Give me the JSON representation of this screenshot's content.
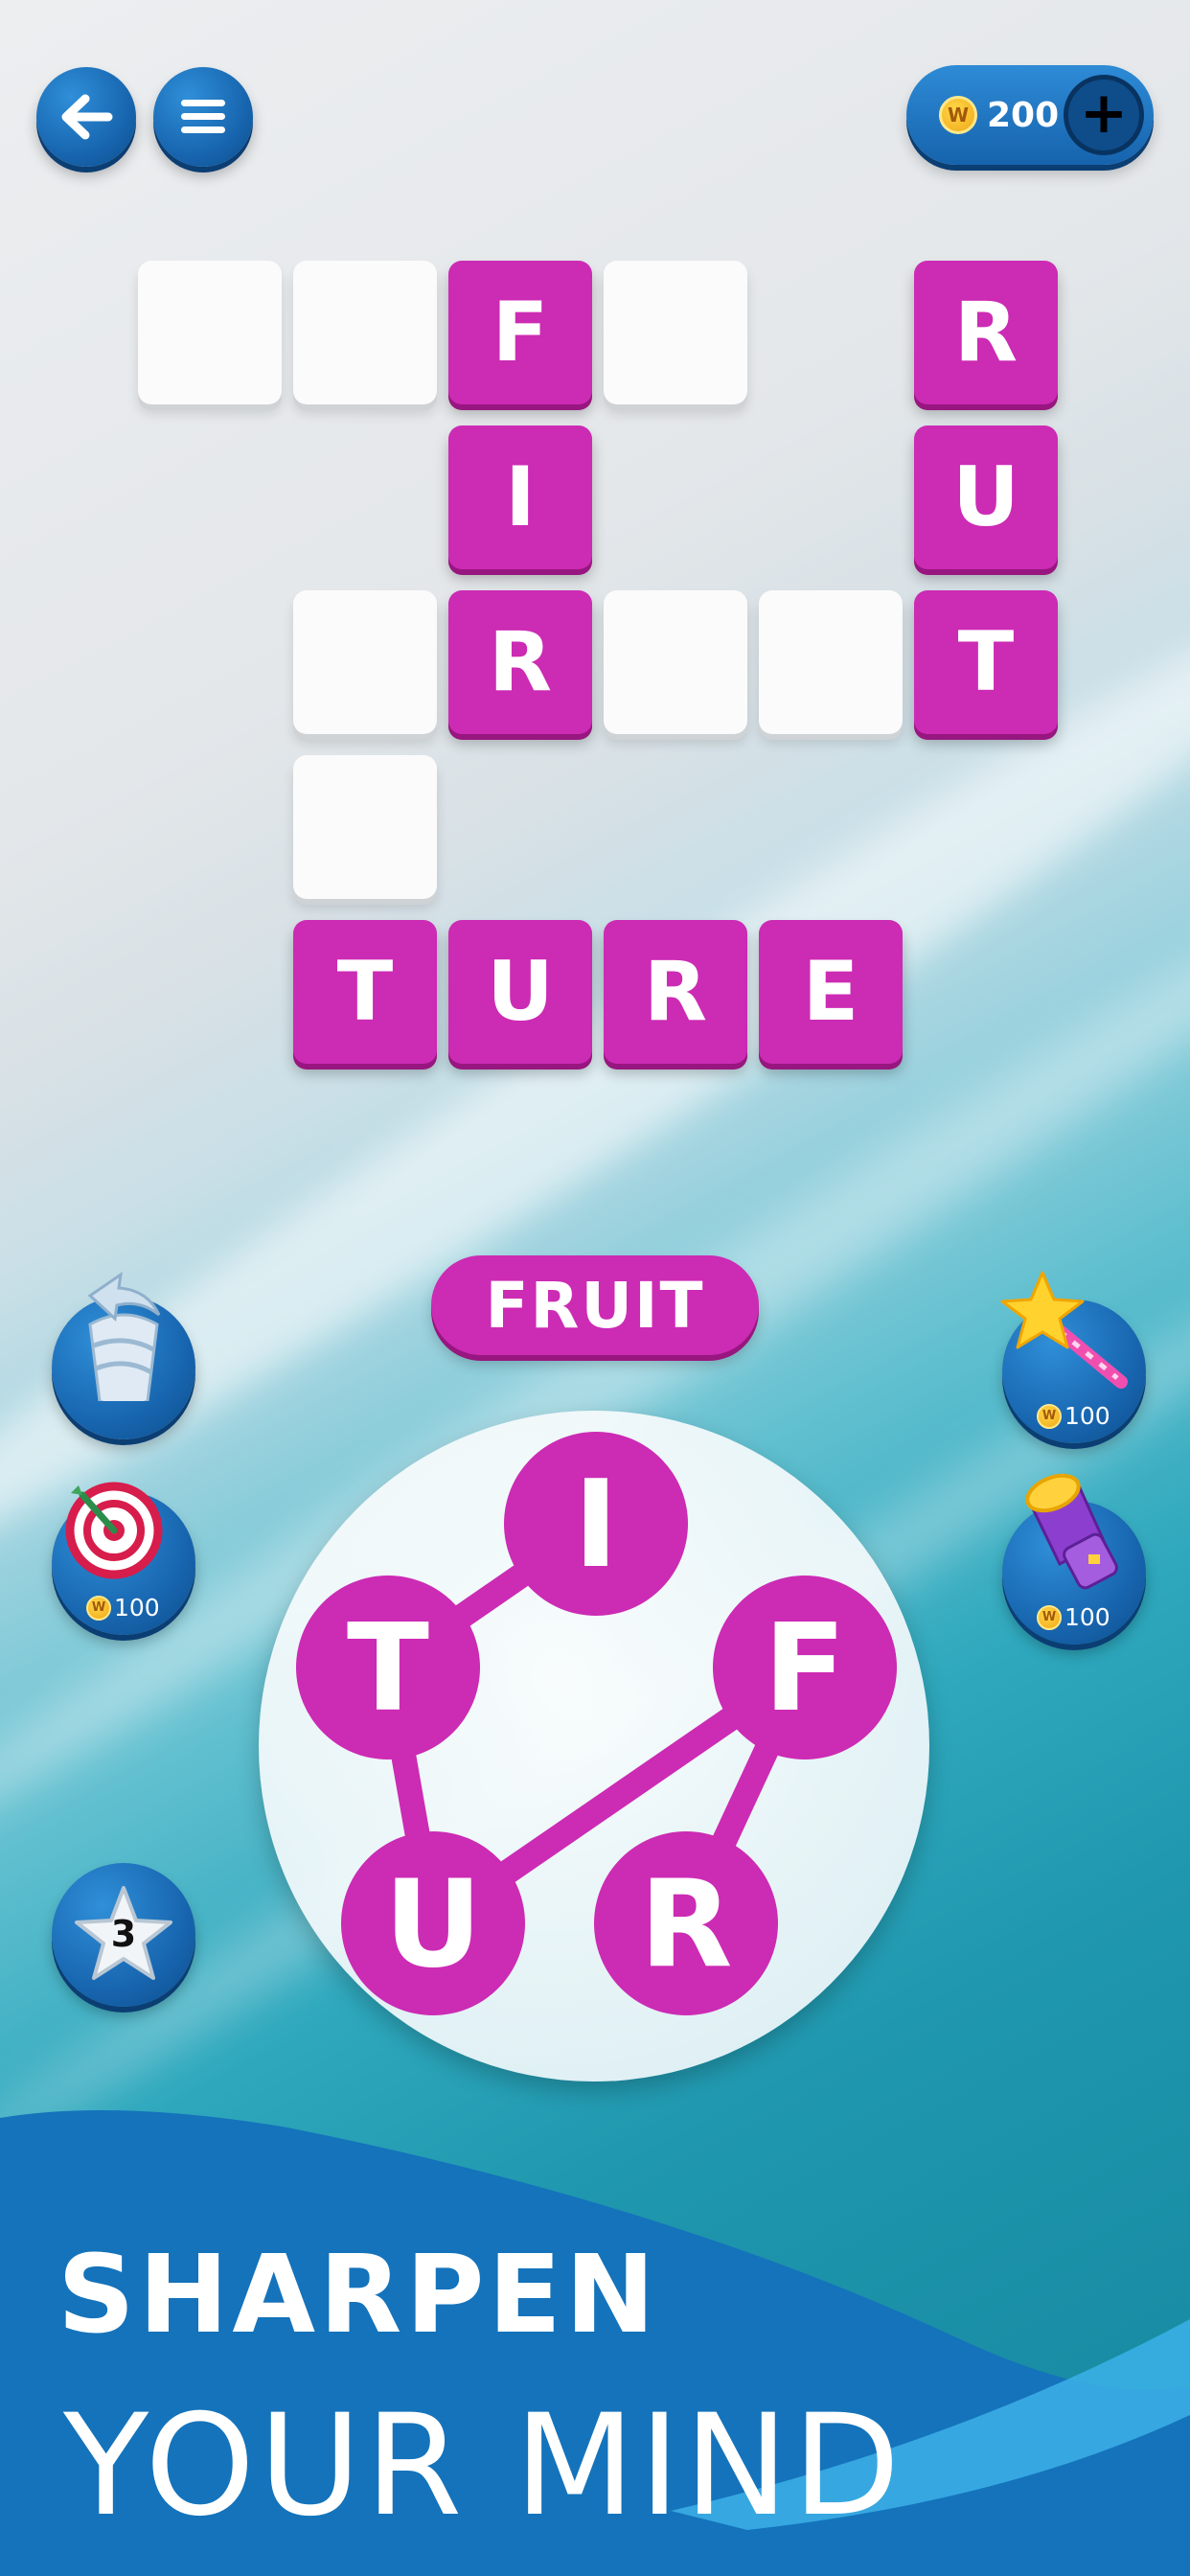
{
  "header": {
    "back_icon": "arrow-left-icon",
    "menu_icon": "hamburger-menu-icon",
    "coins": "200",
    "coin_symbol": "W",
    "add_icon": "plus-icon"
  },
  "board": {
    "row1": [
      "",
      "",
      "F",
      "",
      "",
      "R"
    ],
    "row2": [
      "I",
      "U"
    ],
    "row3": [
      "",
      "R",
      "",
      "",
      "T"
    ],
    "row4": [
      ""
    ],
    "row5": [
      "T",
      "U",
      "R",
      "E"
    ]
  },
  "current_word": "FRUIT",
  "wheel_letters": {
    "top": "I",
    "left": "T",
    "right": "F",
    "bottom_left": "U",
    "bottom_right": "R"
  },
  "tools": {
    "shuffle_icon": "shuffle-icon",
    "target": {
      "icon": "target-icon",
      "cost": "100"
    },
    "magic_wand": {
      "icon": "magic-wand-icon",
      "cost": "100"
    },
    "flashlight": {
      "icon": "flashlight-icon",
      "cost": "100"
    },
    "star": {
      "icon": "star-icon",
      "count": "3"
    }
  },
  "tagline": {
    "line1": "SHARPEN",
    "line2": "YOUR MIND"
  },
  "colors": {
    "tile": "#cc2bb4",
    "button": "#1866b0",
    "banner": "#1578c0"
  }
}
